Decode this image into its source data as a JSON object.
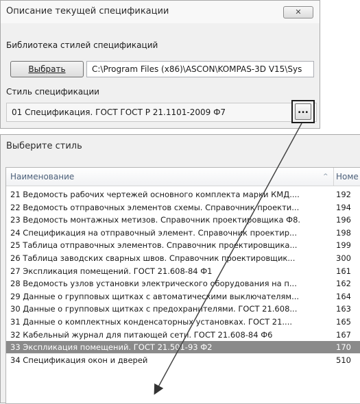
{
  "dialog1": {
    "title": "Описание текущей спецификации",
    "close_icon": "close-icon",
    "library_label": "Библиотека  стилей спецификаций",
    "select_button": "Выбрать",
    "library_path": "C:\\Program Files (x86)\\ASCON\\KOMPAS-3D V15\\Sys",
    "style_label": "Стиль спецификации",
    "style_value": "01 Спецификация. ГОСТ ГОСТ Р 21.1101-2009 Ф7",
    "browse_label": "..."
  },
  "dialog2": {
    "title": "Выберите стиль",
    "columns": {
      "name": "Наименование",
      "number": "Номе"
    },
    "sort_icon": "sort-ascending-icon",
    "rows": [
      {
        "name": "21 Ведомость рабочих чертежей основного комплекта марки КМД....",
        "number": "192"
      },
      {
        "name": "22 Ведомость отправочных элементов схемы. Справочник проекти...",
        "number": "194"
      },
      {
        "name": "23 Ведомость монтажных метизов. Справочник проектировщика Ф8.",
        "number": "196"
      },
      {
        "name": "24 Спецификация на отправочный элемент. Справочник проектир...",
        "number": "198"
      },
      {
        "name": "25 Таблица отправочных элементов. Справочник проектировщика...",
        "number": "199"
      },
      {
        "name": "26 Таблица заводских сварных швов.  Справочник проектировщик...",
        "number": "300"
      },
      {
        "name": "27 Экспликация помещений. ГОСТ 21.608-84 Ф1",
        "number": "161"
      },
      {
        "name": "28 Ведомость узлов установки электрического оборудования на п...",
        "number": "162"
      },
      {
        "name": "29 Данные о групповых щитках с автоматическими выключателям...",
        "number": "164"
      },
      {
        "name": "30 Данные о групповых щитках с предохранителями. ГОСТ 21.608...",
        "number": "163"
      },
      {
        "name": "31 Данные  о комплектных конденсаторных установках. ГОСТ 21....",
        "number": "165"
      },
      {
        "name": "32 Кабельный журнал для питающей сети. ГОСТ 21.608-84 Ф6",
        "number": "167"
      },
      {
        "name": "33 Экспликация помещений. ГОСТ 21.501-93 Ф2",
        "number": "170",
        "selected": true
      },
      {
        "name": "34 Спецификация окон и дверей",
        "number": "510"
      }
    ]
  },
  "colors": {
    "selection": "#8a8a8a",
    "header_text": "#4c607a"
  }
}
